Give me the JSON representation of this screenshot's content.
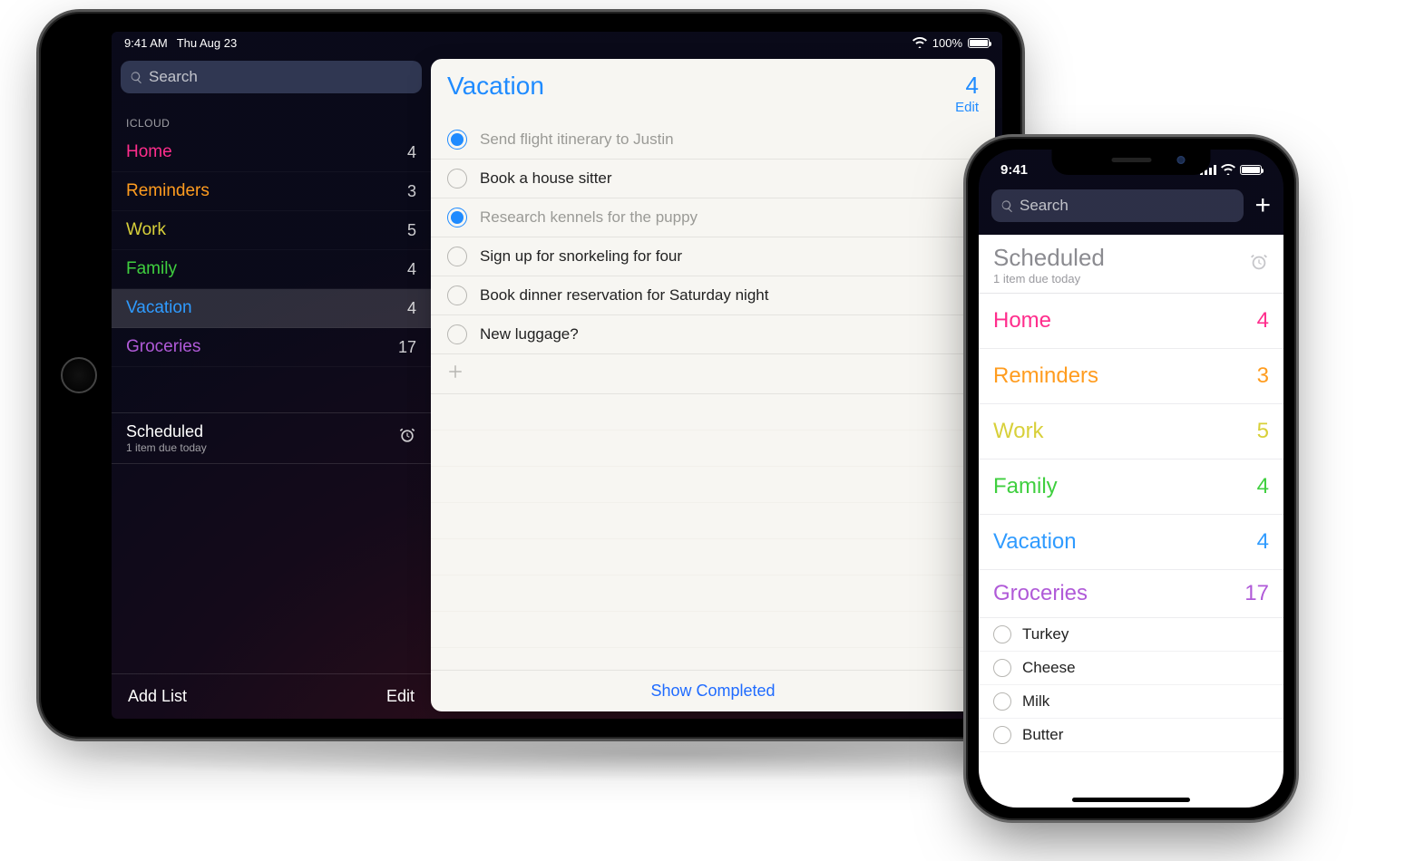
{
  "ipad": {
    "status": {
      "time": "9:41 AM",
      "date": "Thu Aug 23",
      "battery_text": "100%"
    },
    "sidebar": {
      "search_placeholder": "Search",
      "section_label": "ICLOUD",
      "lists": [
        {
          "name": "Home",
          "count": 4,
          "color": "#ff2d8c",
          "selected": false
        },
        {
          "name": "Reminders",
          "count": 3,
          "color": "#ff9c1f",
          "selected": false
        },
        {
          "name": "Work",
          "count": 5,
          "color": "#d8d03a",
          "selected": false
        },
        {
          "name": "Family",
          "count": 4,
          "color": "#3fcf3f",
          "selected": false
        },
        {
          "name": "Vacation",
          "count": 4,
          "color": "#2f9bff",
          "selected": true
        },
        {
          "name": "Groceries",
          "count": 17,
          "color": "#b05ad8",
          "selected": false
        }
      ],
      "scheduled": {
        "title": "Scheduled",
        "subtitle": "1 item due today"
      },
      "footer": {
        "add_list": "Add List",
        "edit": "Edit"
      }
    },
    "detail": {
      "title": "Vacation",
      "count": 4,
      "edit_label": "Edit",
      "items": [
        {
          "text": "Send flight itinerary to Justin",
          "active": true
        },
        {
          "text": "Book a house sitter",
          "active": false
        },
        {
          "text": "Research kennels for the puppy",
          "active": true
        },
        {
          "text": "Sign up for snorkeling for four",
          "active": false
        },
        {
          "text": "Book dinner reservation for Saturday night",
          "active": false
        },
        {
          "text": "New luggage?",
          "active": false
        }
      ],
      "footer_label": "Show Completed"
    }
  },
  "iphone": {
    "status": {
      "time": "9:41"
    },
    "search_placeholder": "Search",
    "scheduled": {
      "title": "Scheduled",
      "subtitle": "1 item due today"
    },
    "lists": [
      {
        "name": "Home",
        "count": 4,
        "color": "#ff2d8c"
      },
      {
        "name": "Reminders",
        "count": 3,
        "color": "#ff9c1f"
      },
      {
        "name": "Work",
        "count": 5,
        "color": "#d8d03a"
      },
      {
        "name": "Family",
        "count": 4,
        "color": "#3fcf3f"
      },
      {
        "name": "Vacation",
        "count": 4,
        "color": "#2f9bff"
      },
      {
        "name": "Groceries",
        "count": 17,
        "color": "#b05ad8"
      }
    ],
    "grocery_items": [
      {
        "text": "Turkey"
      },
      {
        "text": "Cheese"
      },
      {
        "text": "Milk"
      },
      {
        "text": "Butter"
      }
    ]
  }
}
